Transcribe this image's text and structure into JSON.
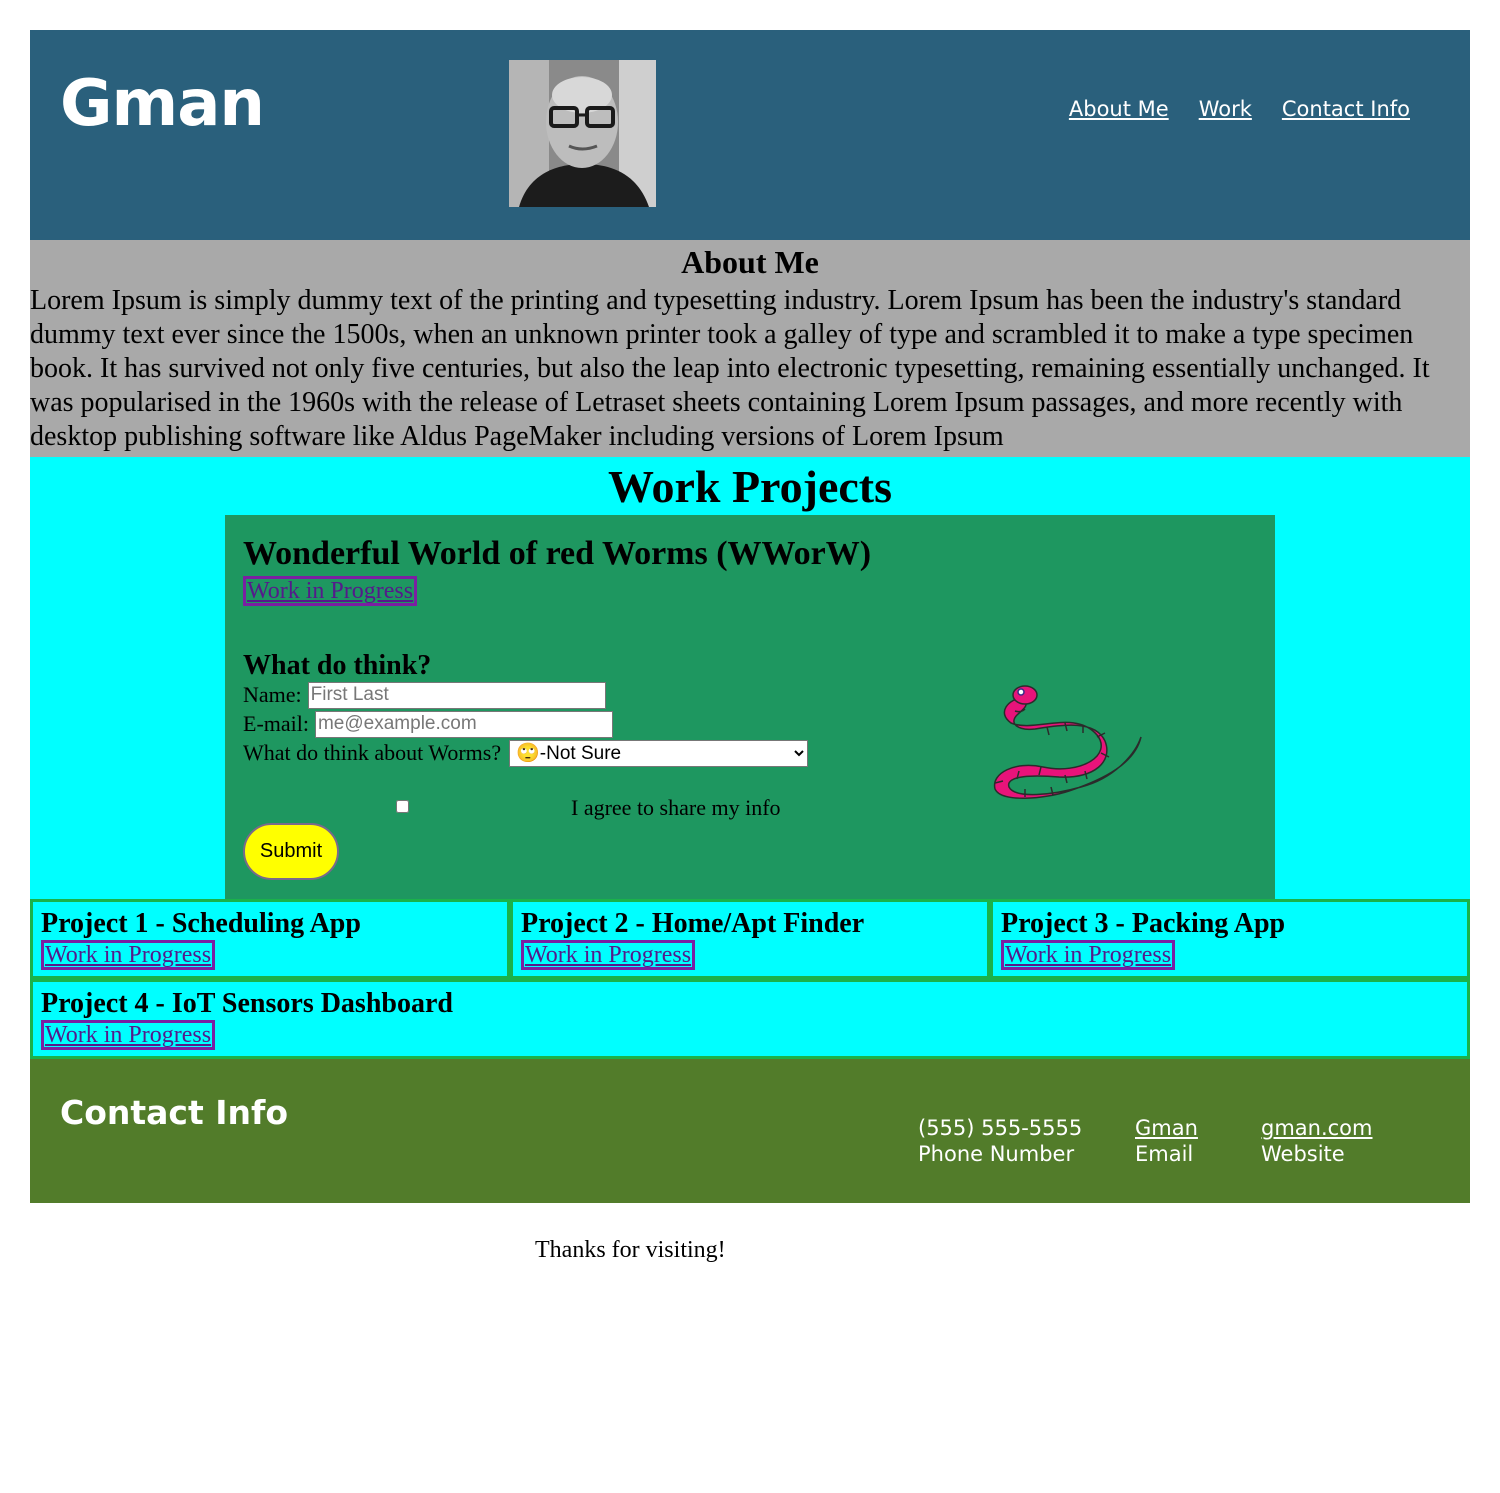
{
  "header": {
    "logo": "Gman",
    "nav": [
      "About Me",
      "Work",
      "Contact Info"
    ]
  },
  "about": {
    "title": "About Me",
    "body": "Lorem Ipsum is simply dummy text of the printing and typesetting industry. Lorem Ipsum has been the industry's standard dummy text ever since the 1500s, when an unknown printer took a galley of type and scrambled it to make a type specimen book. It has survived not only five centuries, but also the leap into electronic typesetting, remaining essentially unchanged. It was popularised in the 1960s with the release of Letraset sheets containing Lorem Ipsum passages, and more recently with desktop publishing software like Aldus PageMaker including versions of Lorem Ipsum"
  },
  "work": {
    "title": "Work Projects",
    "featured": {
      "title": "Wonderful World of red Worms (WWorW)",
      "link": "Work in Progress",
      "form_title": "What do think?",
      "name_label": "Name:",
      "name_placeholder": "First Last",
      "email_label": "E-mail:",
      "email_placeholder": "me@example.com",
      "opinion_label": "What do think about Worms?",
      "opinion_selected": "🙄-Not Sure",
      "agree_label": "I agree to share my info",
      "submit_label": "Submit"
    },
    "projects": [
      {
        "title": "Project 1 - Scheduling App",
        "link": "Work in Progress"
      },
      {
        "title": "Project 2 - Home/Apt Finder",
        "link": "Work in Progress"
      },
      {
        "title": "Project 3 - Packing App",
        "link": "Work in Progress"
      },
      {
        "title": "Project 4 - IoT Sensors Dashboard",
        "link": "Work in Progress"
      }
    ]
  },
  "contact": {
    "title": "Contact Info",
    "phone": "(555) 555-5555",
    "phone_label": "Phone Number",
    "email": "Gman",
    "email_label": "Email",
    "website": "gman.com",
    "website_label": "Website"
  },
  "footer": {
    "note": "Thanks for visiting!"
  },
  "colors": {
    "header_bg": "#2a607c",
    "about_bg": "#a9a9a9",
    "work_bg": "#00ffff",
    "featured_bg": "#1e9760",
    "contact_bg": "#527c2a",
    "submit_bg": "#ffff00",
    "worm": "#e8137a"
  }
}
